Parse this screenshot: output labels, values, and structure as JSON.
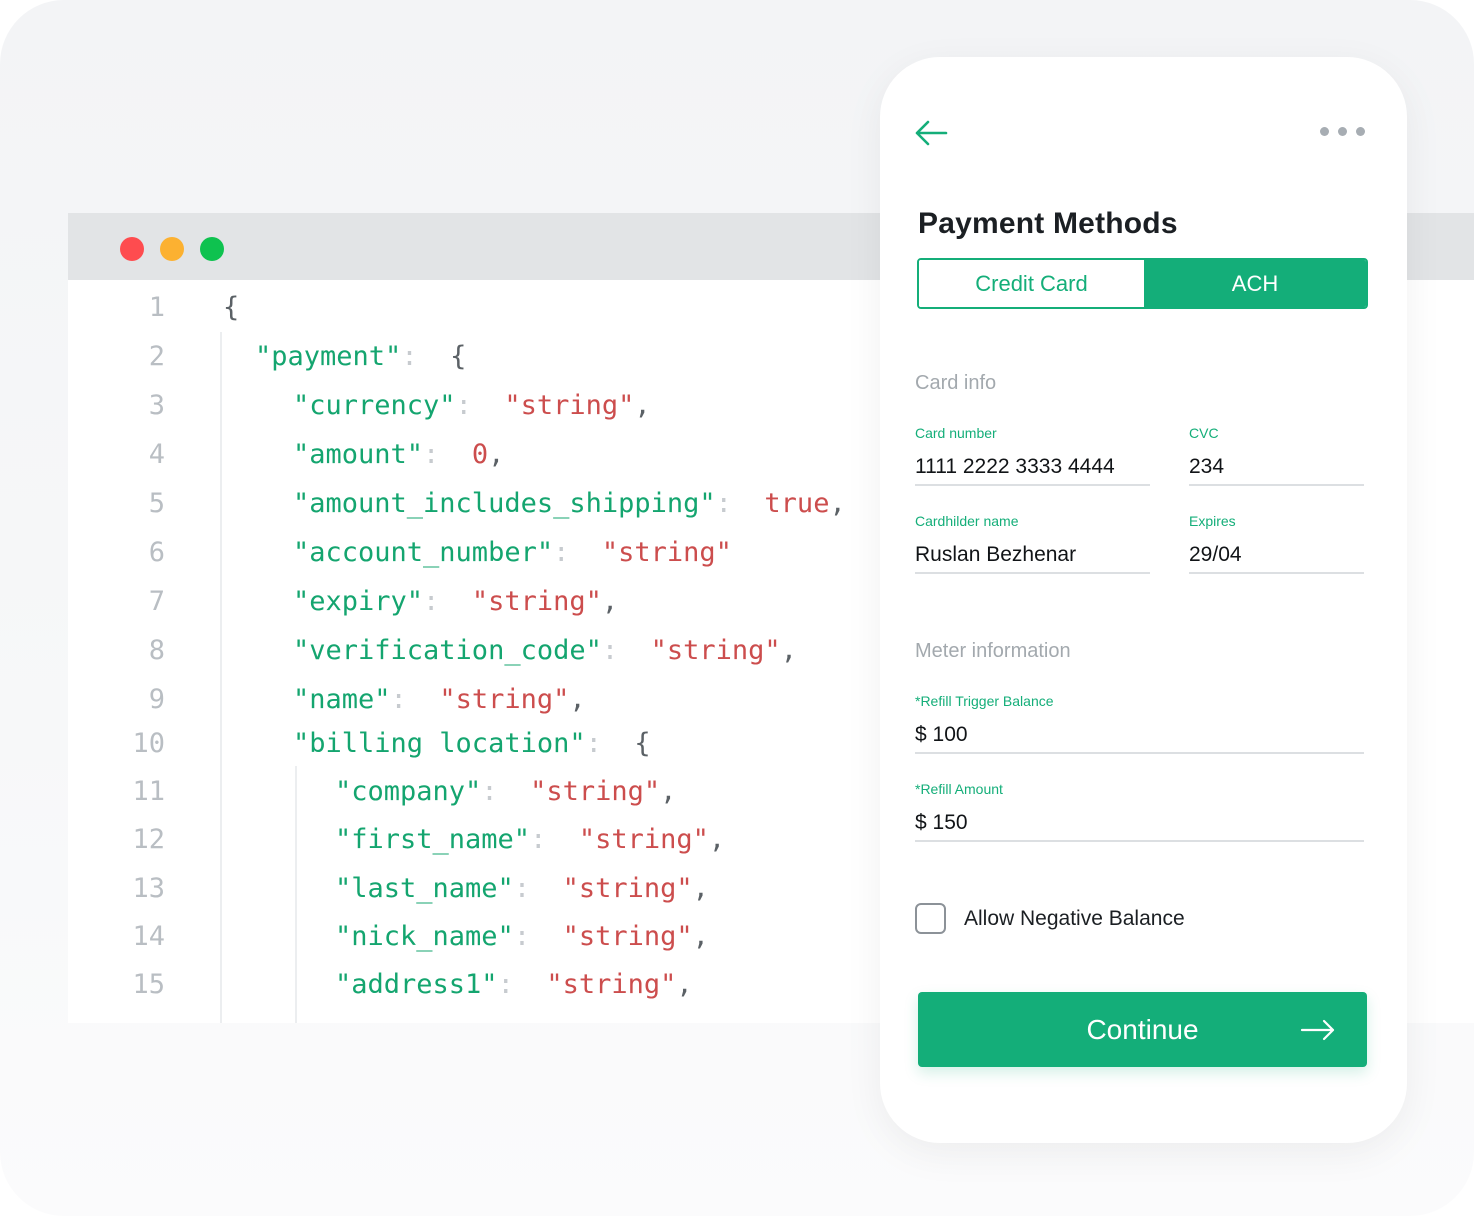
{
  "colors": {
    "accent": "#14ae79",
    "code_key": "#14a56f",
    "code_string": "#cc4d4d",
    "traffic_red": "#fe4c4f",
    "traffic_yellow": "#fcb131",
    "traffic_green": "#0ec24f"
  },
  "editor": {
    "lines": [
      {
        "num": "1",
        "key": "",
        "val": "",
        "trail": "",
        "brace": "{"
      },
      {
        "num": "2",
        "key": "\"payment\"",
        "val": "",
        "trail": "",
        "brace": "{"
      },
      {
        "num": "3",
        "key": "\"currency\"",
        "val": "\"string\"",
        "trail": ",",
        "brace": ""
      },
      {
        "num": "4",
        "key": "\"amount\"",
        "val": "0",
        "trail": ",",
        "brace": ""
      },
      {
        "num": "5",
        "key": "\"amount_includes_shipping\"",
        "val": "true",
        "trail": ",",
        "brace": ""
      },
      {
        "num": "6",
        "key": "\"account_number\"",
        "val": "\"string\"",
        "trail": "",
        "brace": ""
      },
      {
        "num": "7",
        "key": "\"expiry\"",
        "val": "\"string\"",
        "trail": ",",
        "brace": ""
      },
      {
        "num": "8",
        "key": "\"verification_code\"",
        "val": "\"string\"",
        "trail": ",",
        "brace": ""
      },
      {
        "num": "9",
        "key": "\"name\"",
        "val": "\"string\"",
        "trail": ",",
        "brace": ""
      },
      {
        "num": "10",
        "key": "\"billing location\"",
        "val": "",
        "trail": "",
        "brace": "{"
      },
      {
        "num": "11",
        "key": "\"company\"",
        "val": "\"string\"",
        "trail": ",",
        "brace": ""
      },
      {
        "num": "12",
        "key": "\"first_name\"",
        "val": "\"string\"",
        "trail": ",",
        "brace": ""
      },
      {
        "num": "13",
        "key": "\"last_name\"",
        "val": "\"string\"",
        "trail": ",",
        "brace": ""
      },
      {
        "num": "14",
        "key": "\"nick_name\"",
        "val": "\"string\"",
        "trail": ",",
        "brace": ""
      },
      {
        "num": "15",
        "key": "\"address1\"",
        "val": "\"string\"",
        "trail": ",",
        "brace": ""
      }
    ]
  },
  "phone": {
    "title": "Payment Methods",
    "tabs": {
      "credit_card": "Credit Card",
      "ach": "ACH"
    },
    "card_info": {
      "section": "Card info",
      "card_number_label": "Card number",
      "card_number": "1111 2222 3333 4444",
      "cvc_label": "CVC",
      "cvc": "234",
      "holder_label": "Cardhilder name",
      "holder": "Ruslan Bezhenar",
      "expires_label": "Expires",
      "expires": "29/04"
    },
    "meter": {
      "section": "Meter information",
      "trigger_label": "*Refill Trigger Balance",
      "trigger": "$ 100",
      "amount_label": "*Refill Amount",
      "amount": "$ 150"
    },
    "allow_negative": "Allow Negative Balance",
    "continue": "Continue"
  }
}
